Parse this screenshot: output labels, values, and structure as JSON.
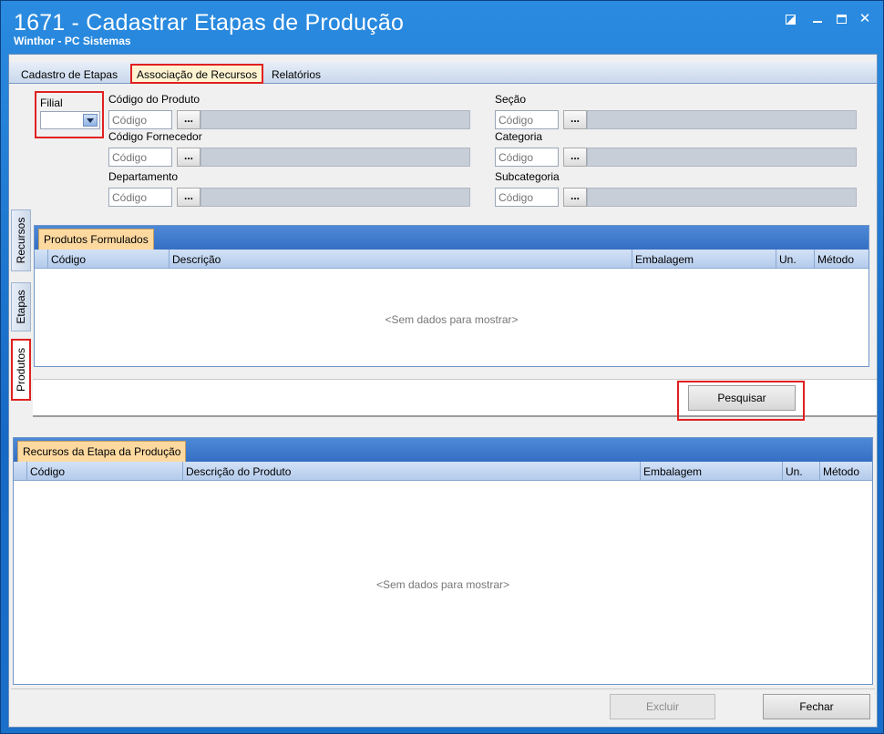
{
  "window": {
    "title": "1671 - Cadastrar Etapas de Produção",
    "subtitle": "Winthor - PC Sistemas"
  },
  "main_tabs": [
    {
      "label": "Cadastro de Etapas",
      "active": false
    },
    {
      "label": "Associação de Recursos",
      "active": true
    },
    {
      "label": "Relatórios",
      "active": false
    }
  ],
  "side_tabs": [
    {
      "label": "Recursos",
      "active": false
    },
    {
      "label": "Etapas",
      "active": false
    },
    {
      "label": "Produtos",
      "active": true
    }
  ],
  "filters": {
    "filial": {
      "label": "Filial",
      "value": ""
    },
    "codigo_produto": {
      "label": "Código do Produto",
      "placeholder": "Código",
      "button": "..."
    },
    "codigo_fornecedor": {
      "label": "Código Fornecedor",
      "placeholder": "Código",
      "button": "..."
    },
    "departamento": {
      "label": "Departamento",
      "placeholder": "Código",
      "button": "..."
    },
    "secao": {
      "label": "Seção",
      "placeholder": "Código",
      "button": "..."
    },
    "categoria": {
      "label": "Categoria",
      "placeholder": "Código",
      "button": "..."
    },
    "subcategoria": {
      "label": "Subcategoria",
      "placeholder": "Código",
      "button": "..."
    }
  },
  "grid_produtos": {
    "tab": "Produtos Formulados",
    "columns": [
      "Código",
      "Descrição",
      "Embalagem",
      "Un.",
      "Método"
    ],
    "empty_text": "<Sem dados para mostrar>"
  },
  "search_button": "Pesquisar",
  "grid_recursos": {
    "tab": "Recursos da Etapa da Produção",
    "columns": [
      "Código",
      "Descrição do Produto",
      "Embalagem",
      "Un.",
      "Método"
    ],
    "empty_text": "<Sem dados para mostrar>"
  },
  "footer": {
    "excluir": "Excluir",
    "fechar": "Fechar"
  },
  "colors": {
    "titlebar": "#1769c4",
    "highlight_outline": "#e02020",
    "grid_tab_active": "#fdd9a0",
    "field_disabled": "#c7ced8"
  }
}
